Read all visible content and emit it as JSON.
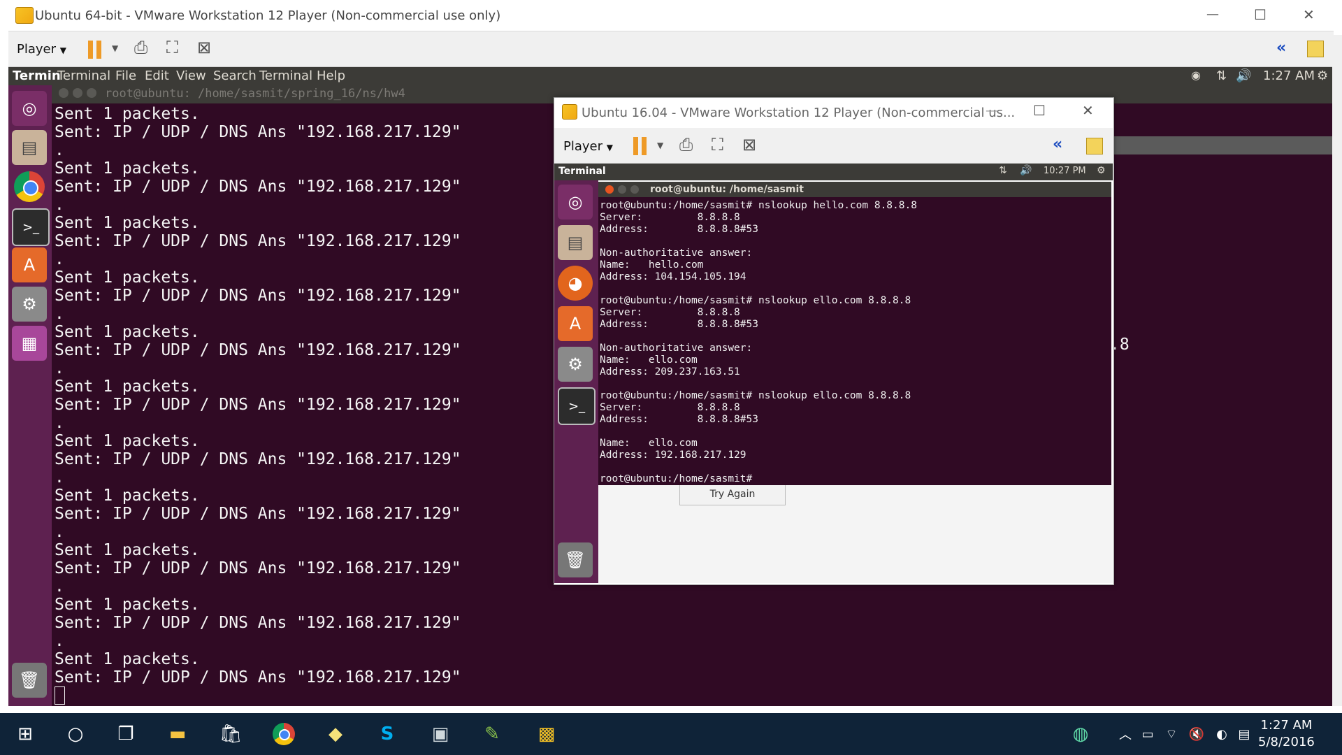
{
  "outer_window": {
    "title": "Ubuntu 64-bit - VMware Workstation 12 Player (Non-commercial use only)",
    "player_label": "Player"
  },
  "ubuntu_menubar": {
    "app_name": "Termin",
    "items": [
      "Terminal",
      "File",
      "Edit",
      "View",
      "Search",
      "Terminal",
      "Help"
    ],
    "time": "1:27 AM"
  },
  "bg_terminal": {
    "title": "root@ubuntu: /home/sasmit/spring_16/ns/hw4",
    "lines": [
      "Sent 1 packets.",
      "Sent: IP / UDP / DNS Ans \"192.168.217.129\"",
      ".",
      "Sent 1 packets.",
      "Sent: IP / UDP / DNS Ans \"192.168.217.129\"",
      ".",
      "Sent 1 packets.",
      "Sent: IP / UDP / DNS Ans \"192.168.217.129\"",
      ".",
      "Sent 1 packets.",
      "Sent: IP / UDP / DNS Ans \"192.168.217.129\"",
      ".",
      "Sent 1 packets.",
      "Sent: IP / UDP / DNS Ans \"192.168.217.129\"",
      ".",
      "Sent 1 packets.",
      "Sent: IP / UDP / DNS Ans \"192.168.217.129\"",
      ".",
      "Sent 1 packets.",
      "Sent: IP / UDP / DNS Ans \"192.168.217.129\"",
      ".",
      "Sent 1 packets.",
      "Sent: IP / UDP / DNS Ans \"192.168.217.129\"",
      ".",
      "Sent 1 packets.",
      "Sent: IP / UDP / DNS Ans \"192.168.217.129\"",
      ".",
      "Sent 1 packets.",
      "Sent: IP / UDP / DNS Ans \"192.168.217.129\"",
      ".",
      "Sent 1 packets.",
      "Sent: IP / UDP / DNS Ans \"192.168.217.129\""
    ],
    "fragment": ".8"
  },
  "inner_window": {
    "title": "Ubuntu 16.04 - VMware Workstation 12 Player (Non-commercial us...",
    "player_label": "Player",
    "menubar_label": "Terminal",
    "time": "10:27 PM",
    "term_title": "root@ubuntu: /home/sasmit",
    "lines": [
      "root@ubuntu:/home/sasmit# nslookup hello.com 8.8.8.8",
      "Server:         8.8.8.8",
      "Address:        8.8.8.8#53",
      "",
      "Non-authoritative answer:",
      "Name:   hello.com",
      "Address: 104.154.105.194",
      "",
      "root@ubuntu:/home/sasmit# nslookup ello.com 8.8.8.8",
      "Server:         8.8.8.8",
      "Address:        8.8.8.8#53",
      "",
      "Non-authoritative answer:",
      "Name:   ello.com",
      "Address: 209.237.163.51",
      "",
      "root@ubuntu:/home/sasmit# nslookup ello.com 8.8.8.8",
      "Server:         8.8.8.8",
      "Address:        8.8.8.8#53",
      "",
      "Name:   ello.com",
      "Address: 192.168.217.129",
      "",
      "root@ubuntu:/home/sasmit#"
    ],
    "try_again_label": "Try Again"
  },
  "taskbar": {
    "time": "1:27 AM",
    "date": "5/8/2016"
  }
}
